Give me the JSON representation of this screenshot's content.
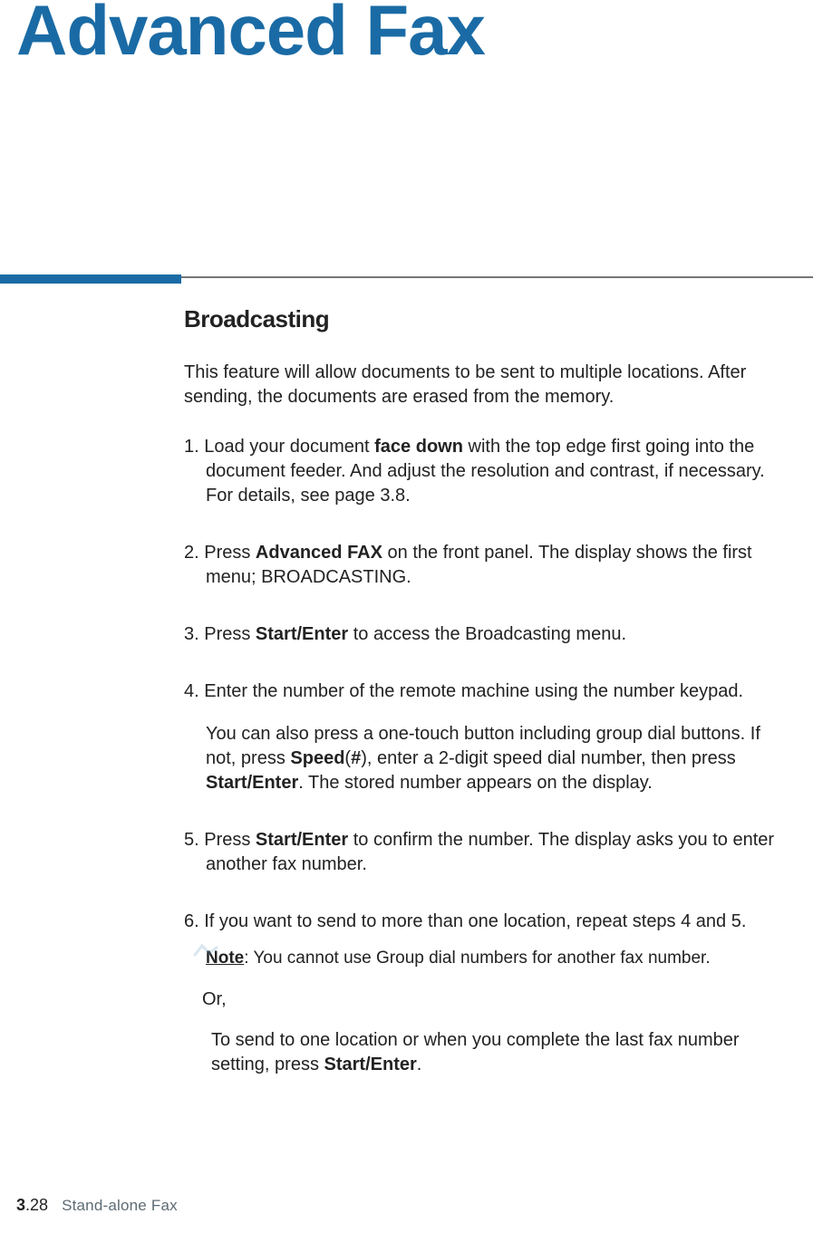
{
  "page_title": "Advanced Fax",
  "section_heading": "Broadcasting",
  "intro": "This feature will allow documents to be sent to multiple locations. After sending, the documents are erased from the memory.",
  "steps": {
    "s1_a": "1. Load your document ",
    "s1_b": "face down",
    "s1_c": " with the top edge first going into the document feeder. And adjust the resolution and contrast, if necessary. For details, see page 3.8.",
    "s2_a": "2. Press ",
    "s2_b": "Advanced FAX",
    "s2_c": " on the front panel. The display shows the first menu; BROADCASTING.",
    "s3_a": "3. Press ",
    "s3_b": "Start/Enter",
    "s3_c": " to access the Broadcasting menu.",
    "s4": "4. Enter the number of the remote machine using the number keypad.",
    "s4sub_a": "You can also press a one-touch button including group dial buttons. If not, press ",
    "s4sub_b": "Speed",
    "s4sub_c": "(",
    "s4sub_d": "#",
    "s4sub_e": "), enter a 2-digit speed dial number, then press ",
    "s4sub_f": "Start/Enter",
    "s4sub_g": ". The stored number appears on the display.",
    "s5_a": "5. Press ",
    "s5_b": "Start/Enter",
    "s5_c": " to confirm the number. The display asks you to enter another fax number.",
    "s6": "6. If you want to send to more than one location, repeat steps 4 and 5.",
    "note_a": "Note",
    "note_b": ": You cannot use Group dial numbers for another fax number.",
    "or": "Or,",
    "final_a": "To send to one location or when you complete the last fax number setting, press ",
    "final_b": "Start/Enter",
    "final_c": "."
  },
  "footer": {
    "page_major": "3",
    "page_minor": ".28",
    "label": "Stand-alone Fax"
  }
}
